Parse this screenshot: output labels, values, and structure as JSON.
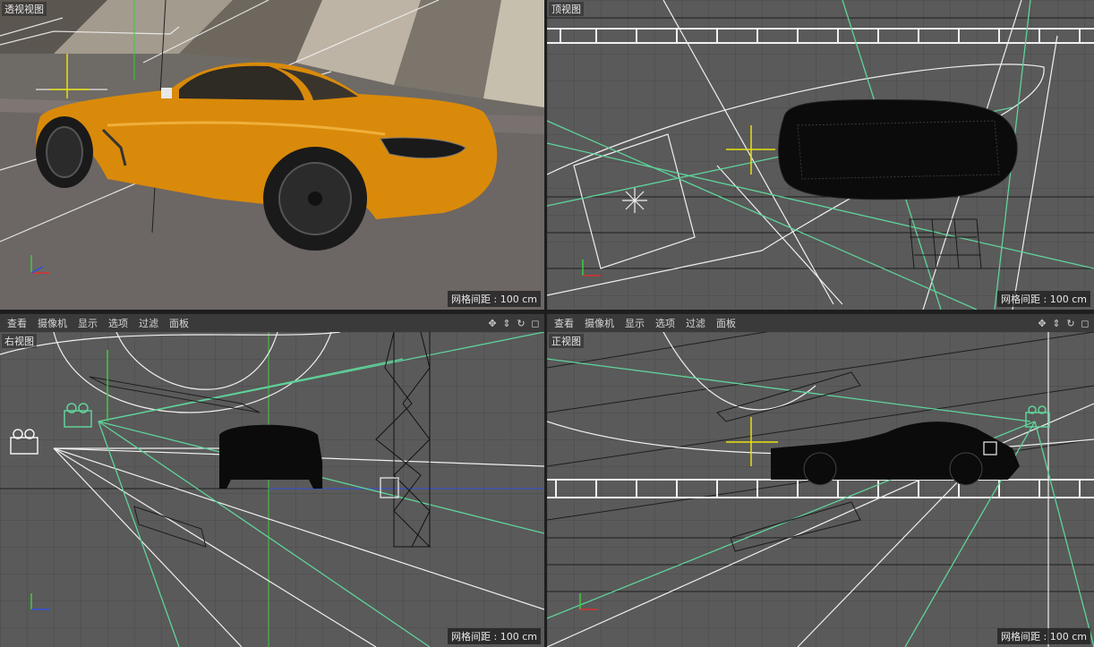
{
  "grid_spacing_label": "网格间距 : 100 cm",
  "viewports": {
    "perspective": {
      "label": "透视视图"
    },
    "top": {
      "label": "顶视图"
    },
    "right": {
      "label": "右视图"
    },
    "front": {
      "label": "正视图"
    }
  },
  "menu": [
    "查看",
    "摄像机",
    "显示",
    "选项",
    "过滤",
    "面板"
  ],
  "tool_icons": [
    "move-view-icon",
    "zoom-view-icon",
    "rotate-view-icon",
    "toggle-view-icon"
  ],
  "colors": {
    "car_body": "#d98a0a",
    "wire_green": "#5fd39a",
    "wire_white": "#f0f0f0",
    "axis_y": "#3ccc3c",
    "axis_x": "#d93030",
    "axis_z": "#3050e0",
    "null_yellow": "#e8e010"
  }
}
